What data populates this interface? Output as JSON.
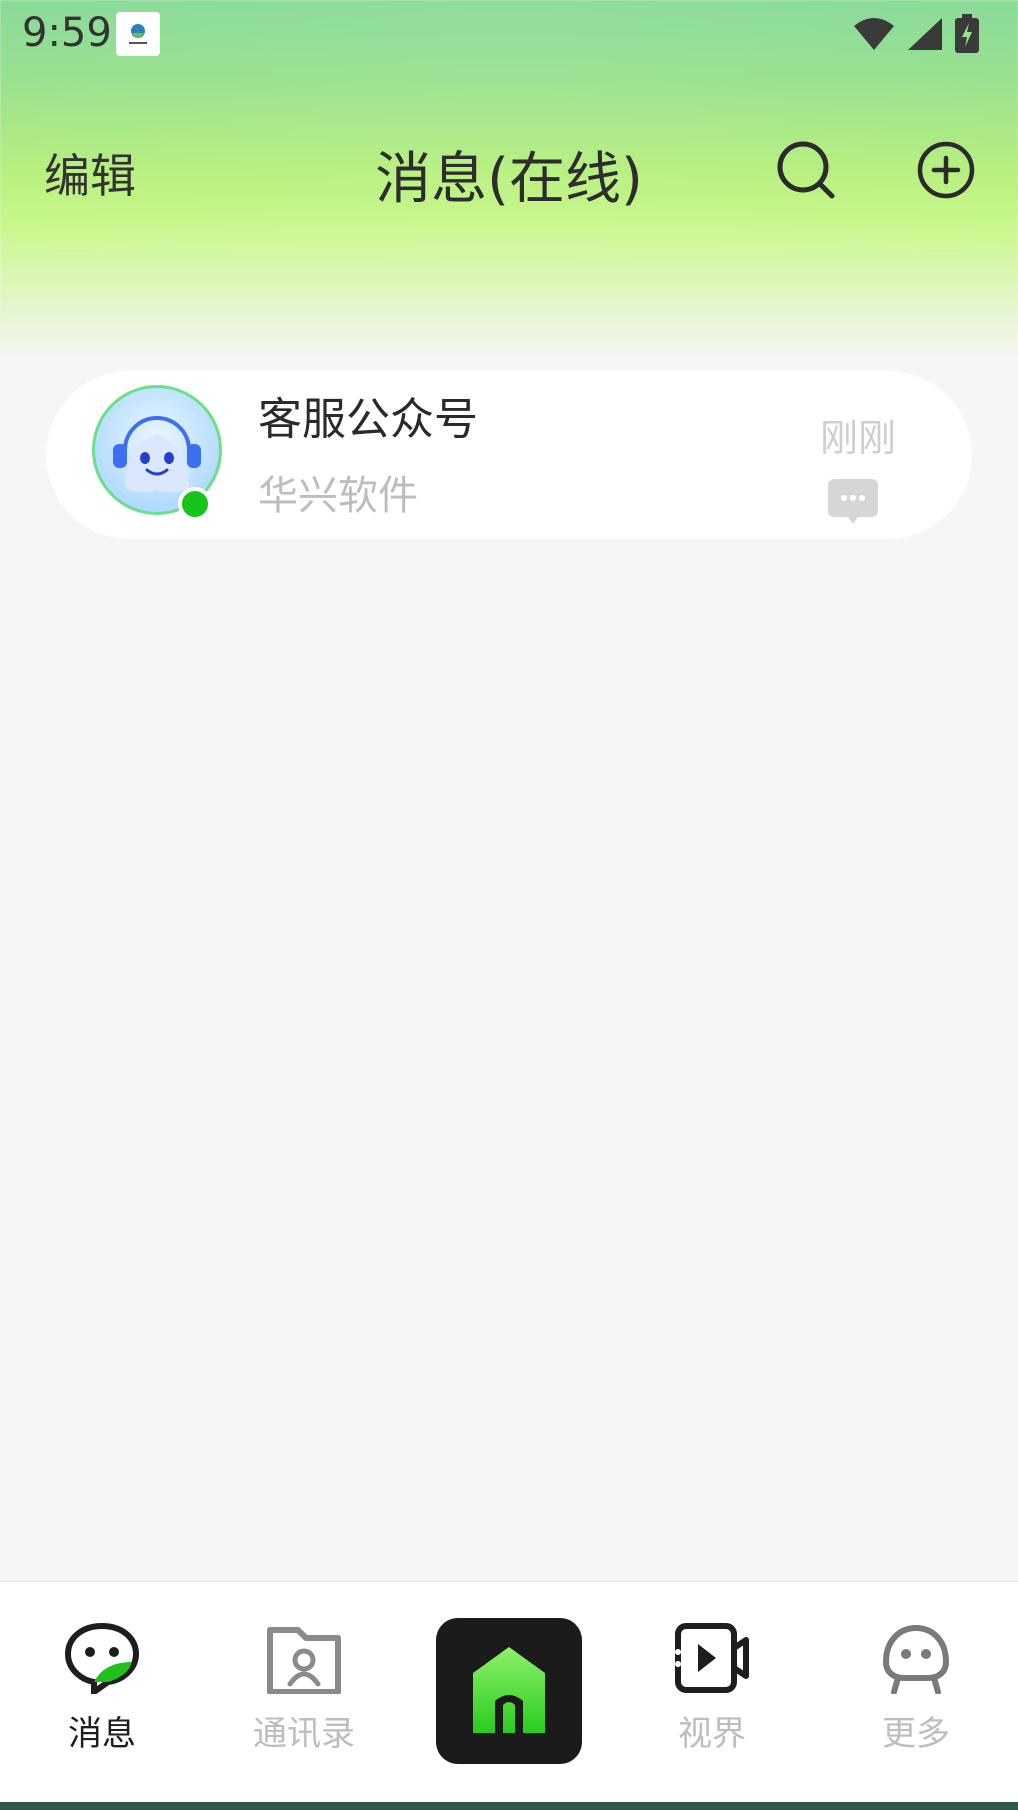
{
  "status_bar": {
    "time": "9:59"
  },
  "header": {
    "edit_label": "编辑",
    "title": "消息(在线)"
  },
  "conversations": [
    {
      "name": "客服公众号",
      "subtitle": "华兴软件",
      "time": "刚刚",
      "online": true
    }
  ],
  "bottom_nav": {
    "items": [
      {
        "label": "消息",
        "active": true
      },
      {
        "label": "通讯录",
        "active": false
      },
      {
        "label": "",
        "active": false
      },
      {
        "label": "视界",
        "active": false
      },
      {
        "label": "更多",
        "active": false
      }
    ]
  },
  "colors": {
    "accent_green": "#17c41a",
    "header_green": "#97e08d",
    "lime": "#c8f78a",
    "inactive_text": "#bdbdbd",
    "active_text": "#1e1e1e"
  },
  "icons": [
    "app-logo-icon",
    "wifi-icon",
    "cellular-icon",
    "battery-icon",
    "search-icon",
    "add-circle-icon",
    "chat-bubble-icon",
    "contacts-icon",
    "home-icon",
    "video-icon",
    "robot-icon"
  ]
}
